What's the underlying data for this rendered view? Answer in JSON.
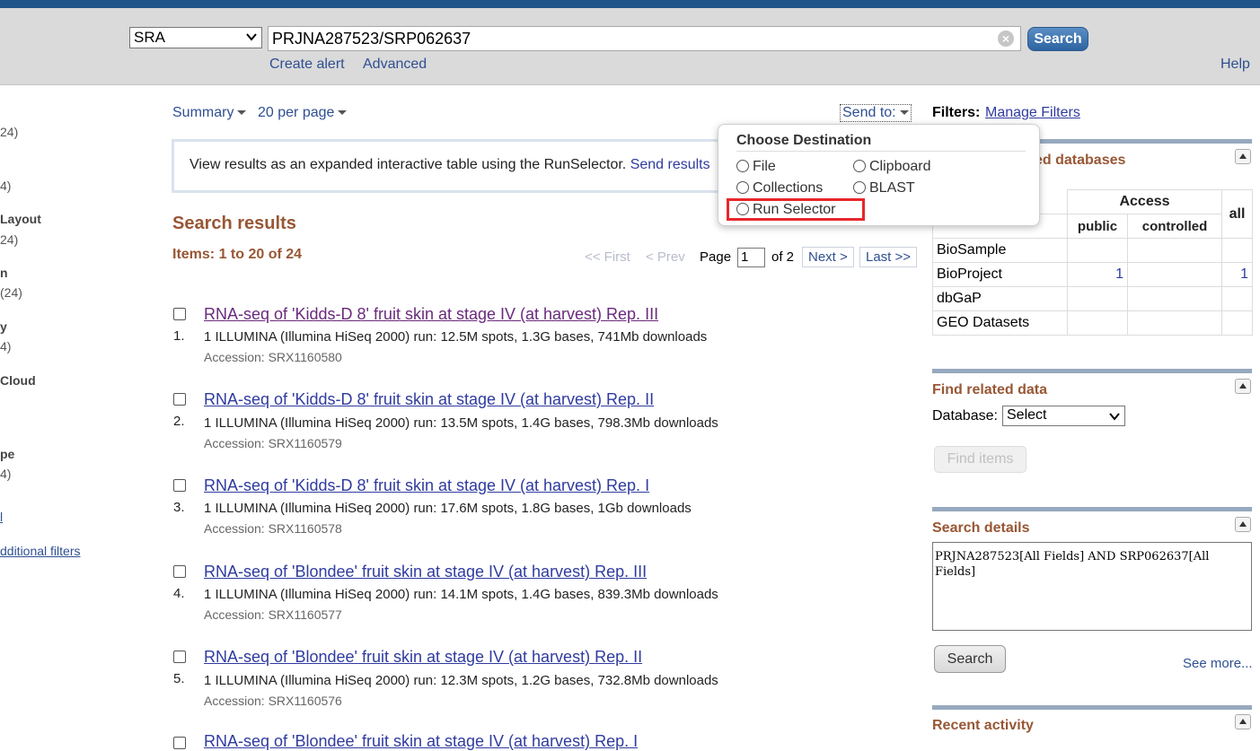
{
  "header": {
    "database": "SRA",
    "search_term": "PRJNA287523/SRP062637",
    "search_button": "Search",
    "create_alert": "Create alert",
    "advanced": "Advanced",
    "help": "Help"
  },
  "left_sidebar_fragments": [
    "24)",
    "4)",
    "Layout",
    "24)",
    "n",
    "(24)",
    "y",
    "4)",
    "Cloud",
    "pe",
    "4)",
    "l",
    "dditional filters"
  ],
  "controls": {
    "format": "Summary",
    "per_page": "20 per page",
    "send_to": "Send to:"
  },
  "info_box": {
    "text": "View results as an expanded interactive table using the RunSelector.",
    "link": "Send results"
  },
  "results_heading": "Search results",
  "items_count": "Items: 1 to 20 of 24",
  "pager": {
    "first": "<< First",
    "prev": "< Prev",
    "page_label": "Page",
    "page_value": "1",
    "of_total": "of 2",
    "next": "Next >",
    "last": "Last >>"
  },
  "results": [
    {
      "num": "1.",
      "title": "RNA-seq of 'Kidds-D 8' fruit skin at stage IV (at harvest) Rep. III",
      "desc": "1 ILLUMINA (Illumina HiSeq 2000) run: 12.5M spots, 1.3G bases, 741Mb downloads",
      "accession": "Accession: SRX1160580"
    },
    {
      "num": "2.",
      "title": "RNA-seq of 'Kidds-D 8' fruit skin at stage IV (at harvest) Rep. II",
      "desc": "1 ILLUMINA (Illumina HiSeq 2000) run: 13.5M spots, 1.4G bases, 798.3Mb downloads",
      "accession": "Accession: SRX1160579"
    },
    {
      "num": "3.",
      "title": "RNA-seq of 'Kidds-D 8' fruit skin at stage IV (at harvest) Rep. I",
      "desc": "1 ILLUMINA (Illumina HiSeq 2000) run: 17.6M spots, 1.8G bases, 1Gb downloads",
      "accession": "Accession: SRX1160578"
    },
    {
      "num": "4.",
      "title": "RNA-seq of 'Blondee' fruit skin at stage IV (at harvest) Rep. III",
      "desc": "1 ILLUMINA (Illumina HiSeq 2000) run: 14.1M spots, 1.4G bases, 839.3Mb downloads",
      "accession": "Accession: SRX1160577"
    },
    {
      "num": "5.",
      "title": "RNA-seq of 'Blondee' fruit skin at stage IV (at harvest) Rep. II",
      "desc": "1 ILLUMINA (Illumina HiSeq 2000) run: 12.3M spots, 1.2G bases, 732.8Mb downloads",
      "accession": "Accession: SRX1160576"
    },
    {
      "title": "RNA-seq of 'Blondee' fruit skin at stage IV (at harvest) Rep. I"
    }
  ],
  "right": {
    "filters_label": "Filters:",
    "manage_filters": "Manage Filters",
    "related_db_title": "ed databases",
    "access_header": "Access",
    "public": "public",
    "controlled": "controlled",
    "all": "all",
    "rows": [
      {
        "name": "BioSample",
        "public": "",
        "all": ""
      },
      {
        "name": "BioProject",
        "public": "1",
        "all": "1"
      },
      {
        "name": "dbGaP",
        "public": "",
        "all": ""
      },
      {
        "name": "GEO Datasets",
        "public": "",
        "all": ""
      }
    ],
    "find_related_title": "Find related data",
    "database_label": "Database:",
    "database_value": "Select",
    "find_items": "Find items",
    "search_details_title": "Search details",
    "search_details_text": "PRJNA287523[All Fields] AND SRP062637[All Fields]",
    "search_button": "Search",
    "see_more": "See more...",
    "recent_activity_title": "Recent activity"
  },
  "popup": {
    "title": "Choose Destination",
    "options": [
      "File",
      "Clipboard",
      "Collections",
      "BLAST",
      "Run Selector"
    ]
  },
  "colors": {
    "header_bar": "#20558a",
    "search_bar_bg": "#dadada",
    "heading_brown": "#985735",
    "link_blue": "#2f3b9f",
    "highlight_red": "#e8262b"
  }
}
